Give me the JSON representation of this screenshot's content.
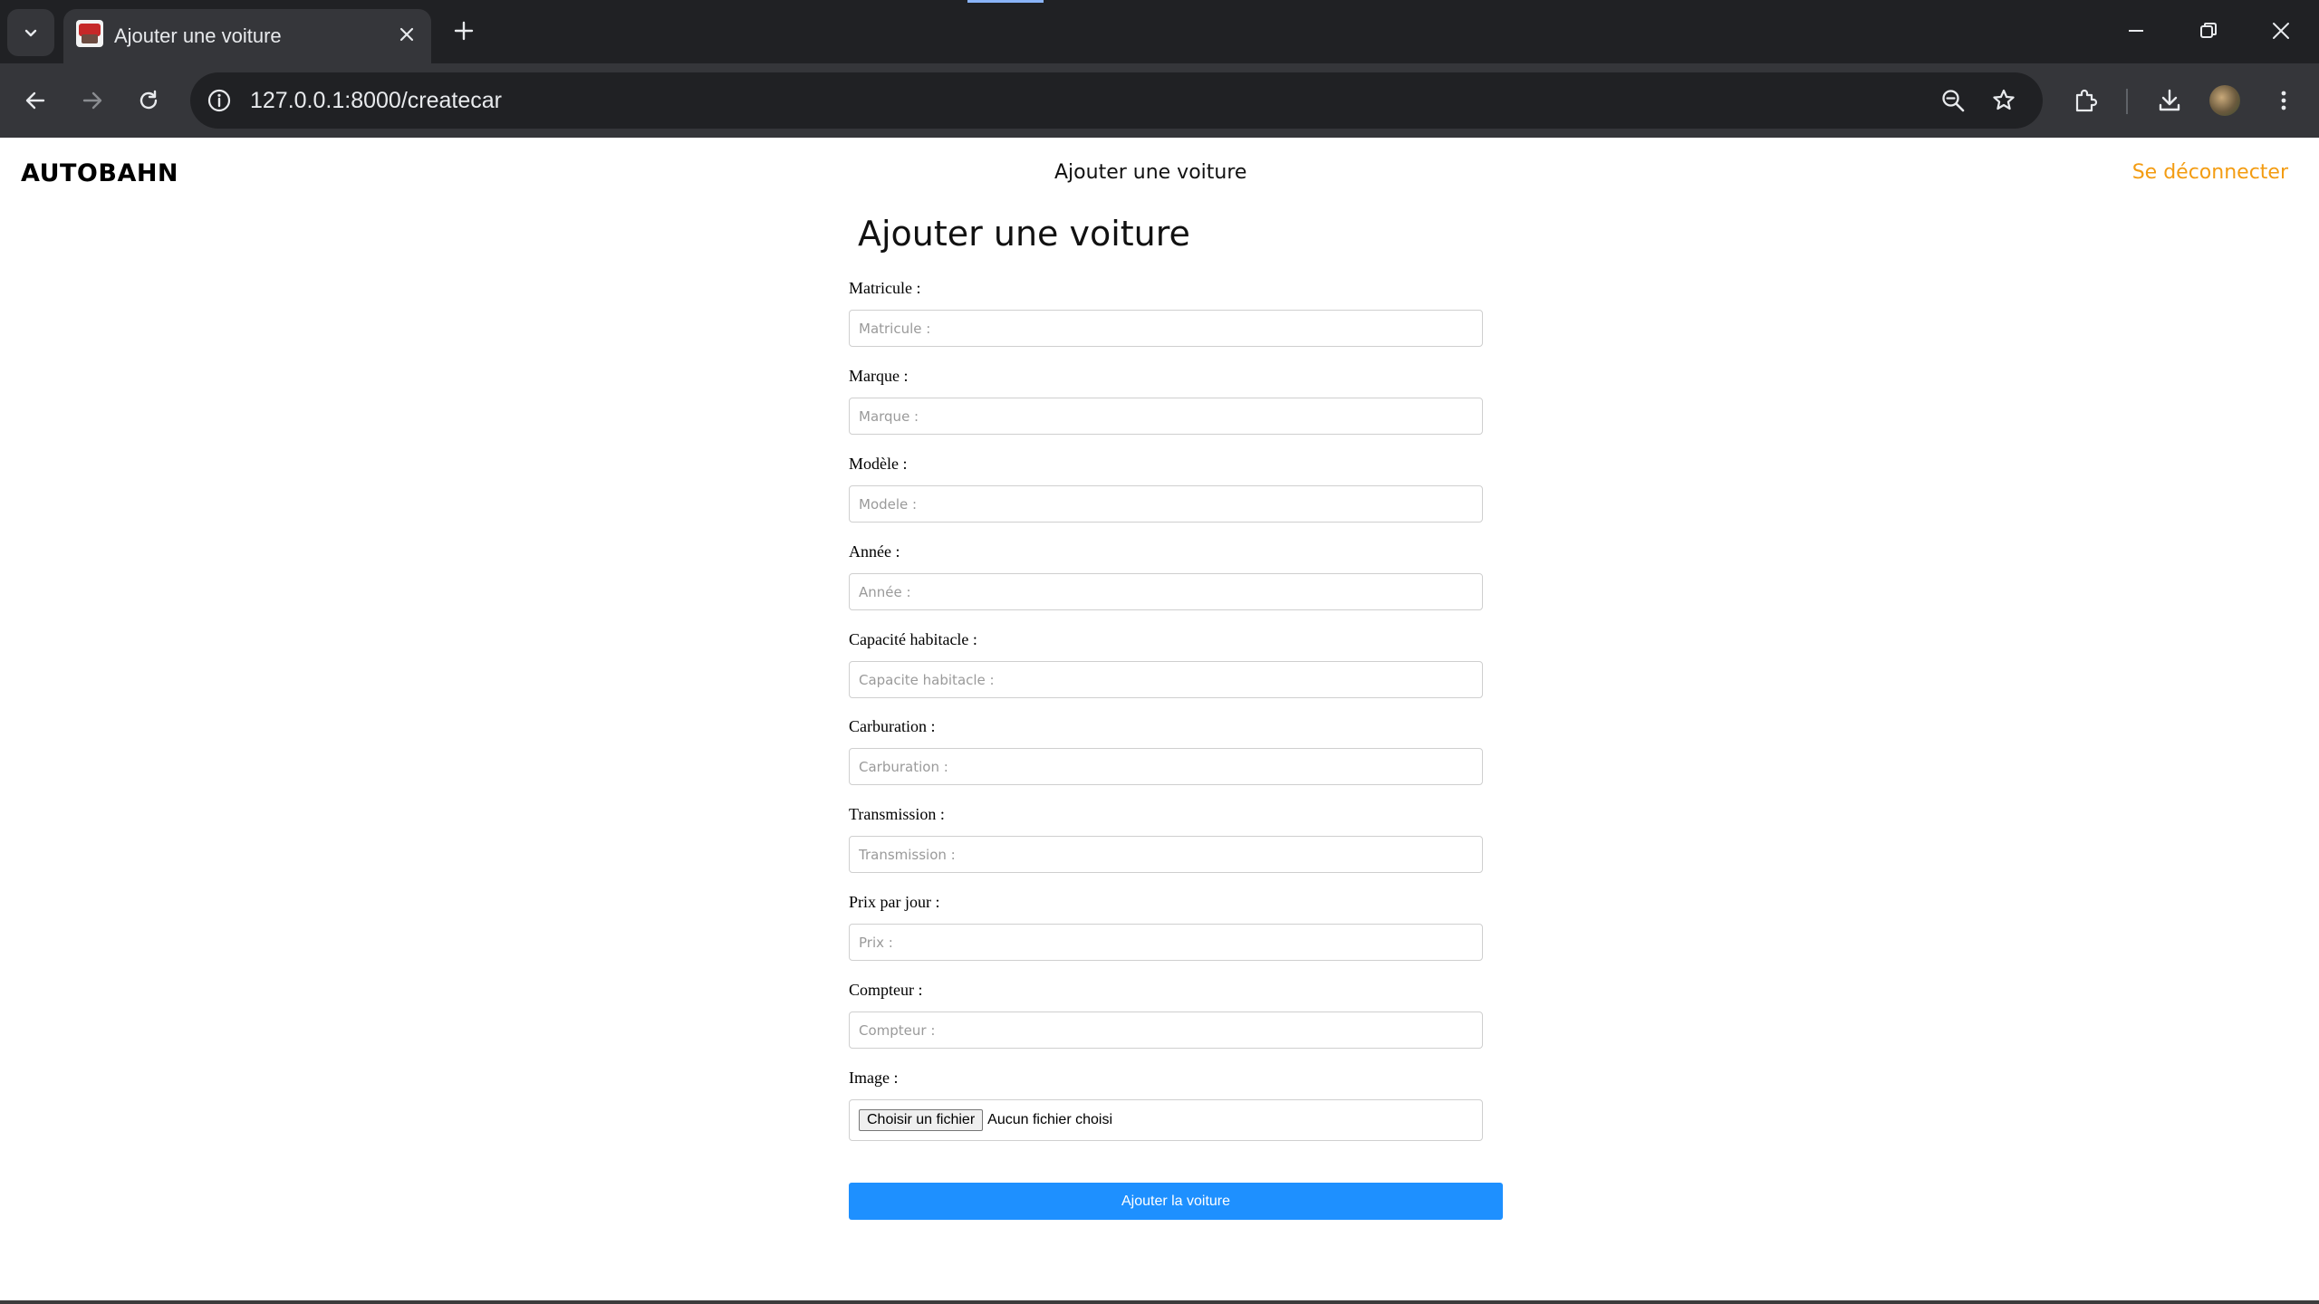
{
  "browser": {
    "tab_title": "Ajouter une voiture",
    "url": "127.0.0.1:8000/createcar"
  },
  "header": {
    "logo": "AUTOBAHN",
    "nav_title": "Ajouter une voiture",
    "logout": "Se déconnecter",
    "logout_color": "#f39c12"
  },
  "form": {
    "title": "Ajouter une voiture",
    "fields": [
      {
        "label": "Matricule :",
        "placeholder": "Matricule :"
      },
      {
        "label": "Marque :",
        "placeholder": "Marque :"
      },
      {
        "label": "Modèle :",
        "placeholder": "Modele :"
      },
      {
        "label": "Année :",
        "placeholder": "Année :"
      },
      {
        "label": "Capacité habitacle :",
        "placeholder": "Capacite habitacle :"
      },
      {
        "label": "Carburation :",
        "placeholder": "Carburation :"
      },
      {
        "label": "Transmission :",
        "placeholder": "Transmission :"
      },
      {
        "label": "Prix par jour :",
        "placeholder": "Prix :"
      },
      {
        "label": "Compteur :",
        "placeholder": "Compteur :"
      }
    ],
    "image": {
      "label": "Image :",
      "button": "Choisir un fichier",
      "status": "Aucun fichier choisi"
    },
    "submit": "Ajouter la voiture",
    "submit_color": "#1e90ff"
  }
}
